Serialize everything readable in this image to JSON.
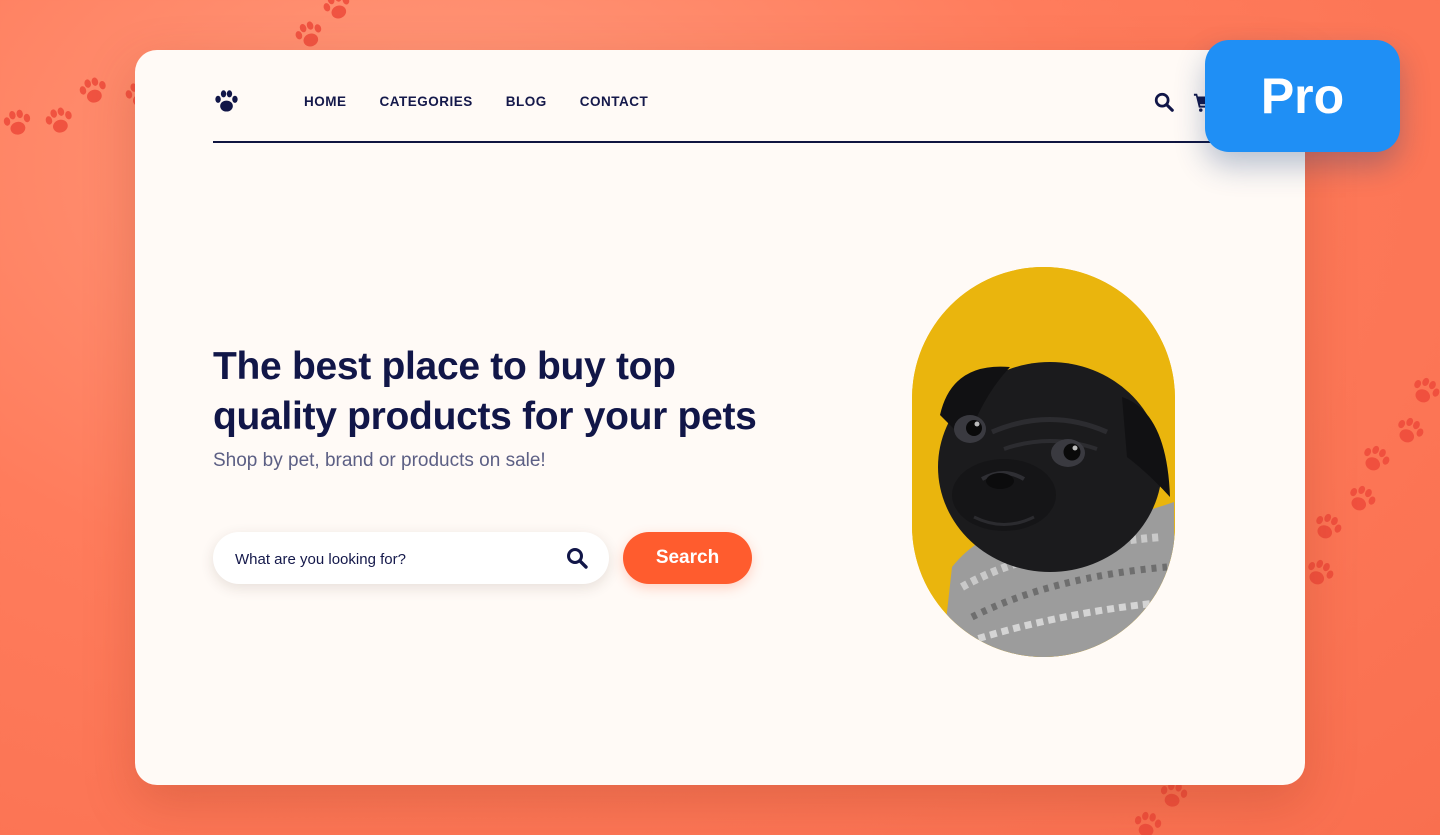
{
  "colors": {
    "background": "#ff7c5c",
    "card": "#fffaf6",
    "text_dark": "#111648",
    "text_muted": "#5c5f84",
    "accent": "#ff5c2e",
    "pet_background": "#eab50d",
    "badge": "#1f8ff5"
  },
  "navbar": {
    "logo_icon": "paw-icon",
    "links": [
      "HOME",
      "CATEGORIES",
      "BLOG",
      "CONTACT"
    ],
    "search_icon": "search-icon",
    "cart_icon": "cart-icon"
  },
  "hero": {
    "title_line1": "The best place to buy top",
    "title_line2": "quality products for your pets",
    "subtitle": "Shop by pet, brand or products on sale!"
  },
  "search": {
    "placeholder": "What are you looking for?",
    "icon": "search-icon",
    "button_label": "Search"
  },
  "image": {
    "subject": "black-pug-with-knit-scarf"
  },
  "badge": {
    "label": "Pro"
  }
}
